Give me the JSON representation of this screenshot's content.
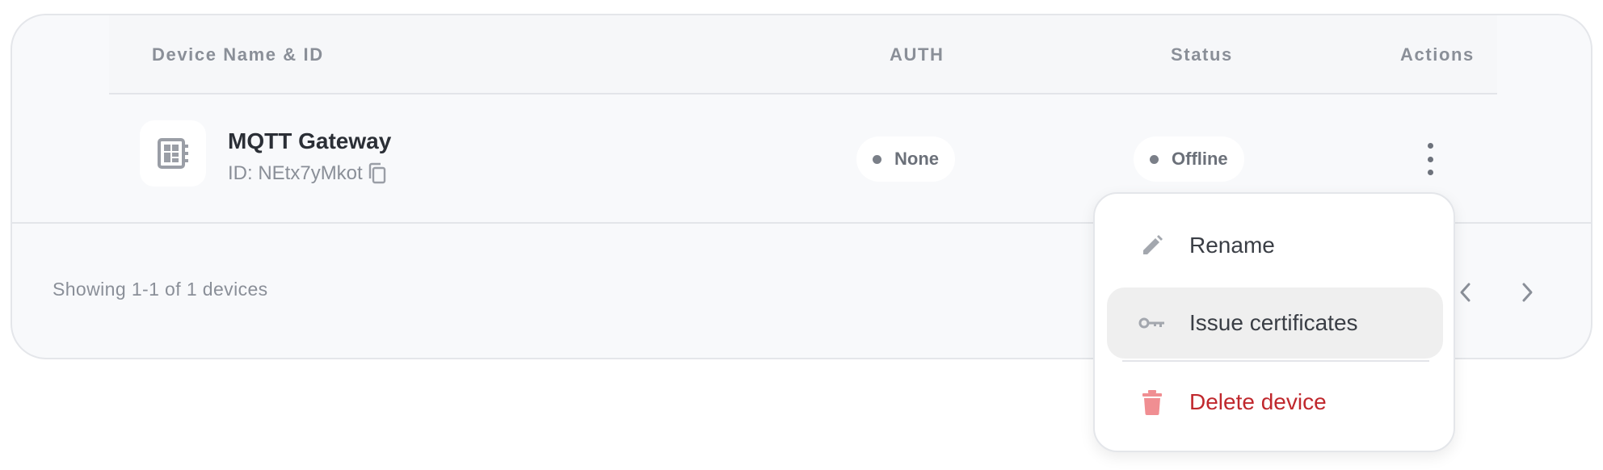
{
  "table": {
    "headers": {
      "name": "Device Name & ID",
      "auth": "AUTH",
      "status": "Status",
      "actions": "Actions"
    },
    "rows": [
      {
        "name": "MQTT Gateway",
        "id": "ID: NEtx7yMkot",
        "auth": "None",
        "status": "Offline"
      }
    ]
  },
  "footer": {
    "summary": "Showing 1-1 of 1 devices"
  },
  "menu": {
    "items": [
      {
        "label": "Rename",
        "icon": "pencil-icon"
      },
      {
        "label": "Issue certificates",
        "icon": "key-icon"
      },
      {
        "label": "Delete device",
        "icon": "trash-icon"
      }
    ]
  },
  "colors": {
    "danger": "#c0282d",
    "danger_icon": "#f08e92",
    "muted": "#8a8f98",
    "card_bg": "#f8f9fb"
  }
}
